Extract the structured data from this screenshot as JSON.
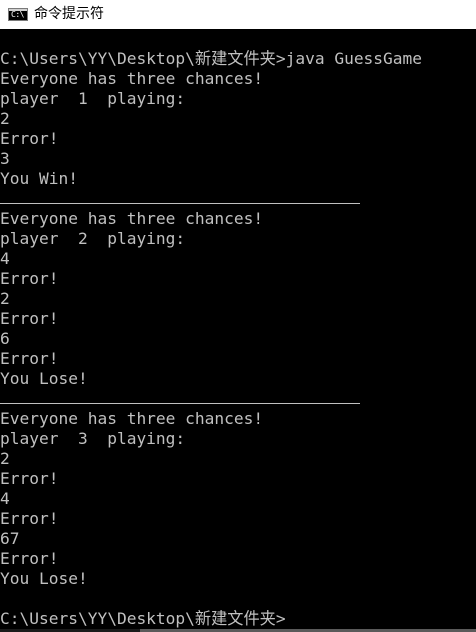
{
  "window": {
    "title": "命令提示符",
    "icon": "cmd-icon",
    "icon_glyph": "C:\\"
  },
  "console": {
    "lines": [
      {
        "type": "text",
        "text": "C:\\Users\\YY\\Desktop\\新建文件夹>java GuessGame"
      },
      {
        "type": "text",
        "text": "Everyone has three chances!"
      },
      {
        "type": "text",
        "text": "player  1  playing:"
      },
      {
        "type": "text",
        "text": "2"
      },
      {
        "type": "text",
        "text": "Error!"
      },
      {
        "type": "text",
        "text": "3"
      },
      {
        "type": "text",
        "text": "You Win!"
      },
      {
        "type": "separator"
      },
      {
        "type": "text",
        "text": "Everyone has three chances!"
      },
      {
        "type": "text",
        "text": "player  2  playing:"
      },
      {
        "type": "text",
        "text": "4"
      },
      {
        "type": "text",
        "text": "Error!"
      },
      {
        "type": "text",
        "text": "2"
      },
      {
        "type": "text",
        "text": "Error!"
      },
      {
        "type": "text",
        "text": "6"
      },
      {
        "type": "text",
        "text": "Error!"
      },
      {
        "type": "text",
        "text": "You Lose!"
      },
      {
        "type": "separator"
      },
      {
        "type": "text",
        "text": "Everyone has three chances!"
      },
      {
        "type": "text",
        "text": "player  3  playing:"
      },
      {
        "type": "text",
        "text": "2"
      },
      {
        "type": "text",
        "text": "Error!"
      },
      {
        "type": "text",
        "text": "4"
      },
      {
        "type": "text",
        "text": "Error!"
      },
      {
        "type": "text",
        "text": "67"
      },
      {
        "type": "text",
        "text": "Error!"
      },
      {
        "type": "text",
        "text": "You Lose!"
      },
      {
        "type": "blank"
      },
      {
        "type": "text",
        "text": "C:\\Users\\YY\\Desktop\\新建文件夹>"
      }
    ]
  },
  "colors": {
    "background": "#000000",
    "foreground": "#c0c0c0",
    "titlebar": "#ffffff"
  }
}
